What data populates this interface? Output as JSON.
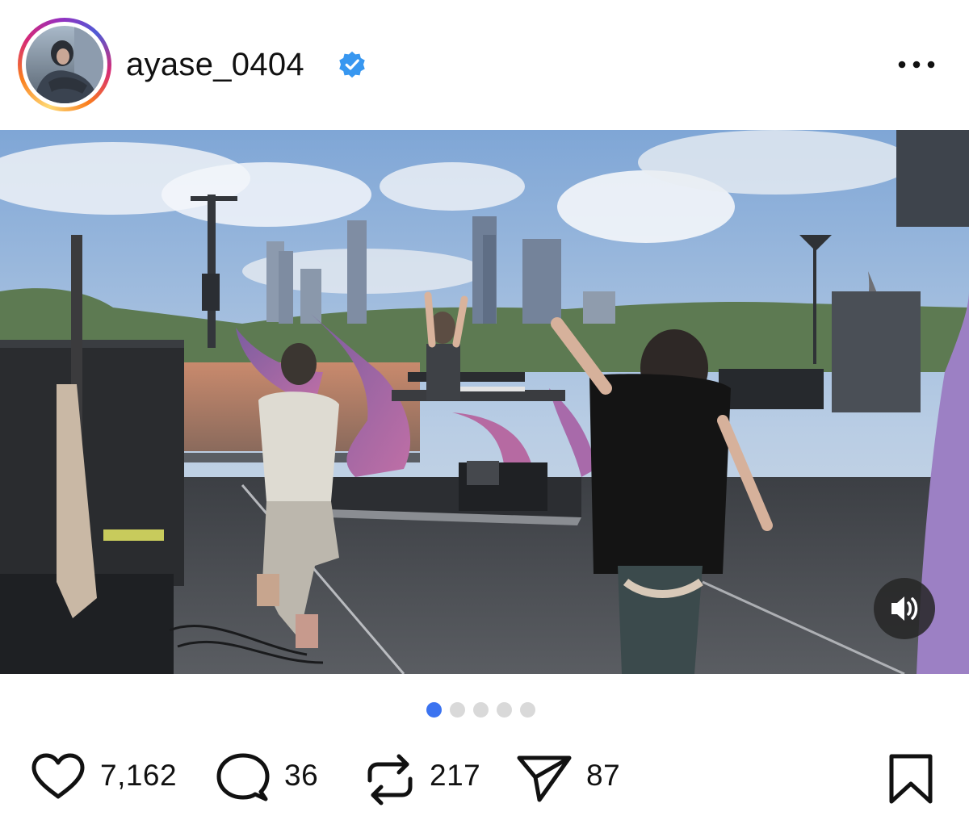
{
  "post": {
    "username": "ayase_0404",
    "verified": true,
    "avatar_icon": "profile-photo",
    "more_icon": "more-horizontal-icon"
  },
  "media": {
    "type": "video",
    "sound_icon": "speaker-on-icon",
    "carousel": {
      "total": 5,
      "active_index": 0
    }
  },
  "actions": {
    "likes": "7,162",
    "comments": "36",
    "reposts": "217",
    "shares": "87"
  },
  "colors": {
    "verified_blue": "#3897f0",
    "active_dot": "#3b73f0",
    "inactive_dot": "#d9d9d9"
  }
}
